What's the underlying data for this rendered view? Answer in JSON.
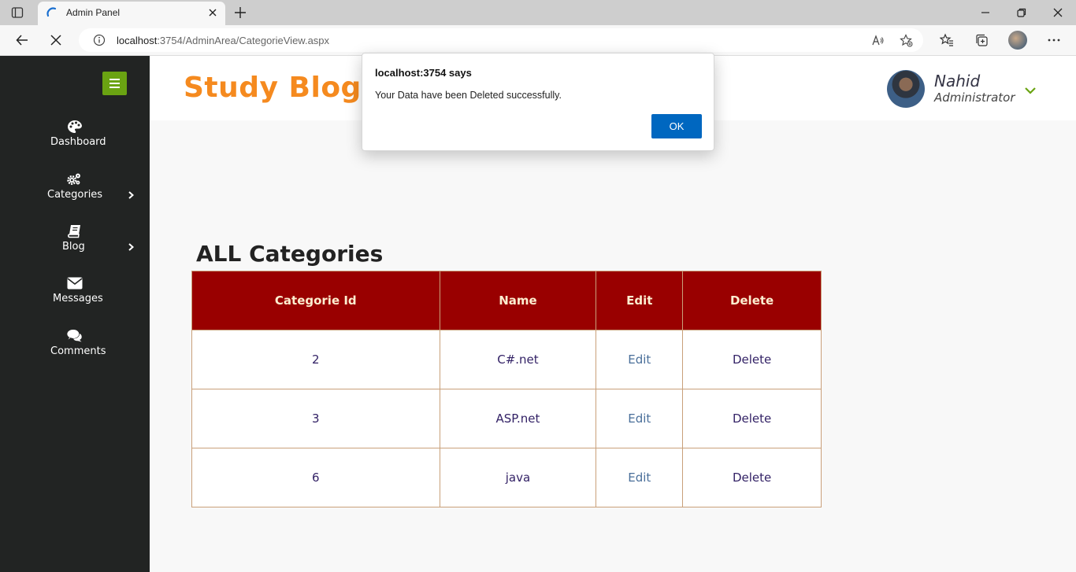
{
  "browser": {
    "tab_title": "Admin Panel",
    "url_host": "localhost",
    "url_rest": ":3754/AdminArea/CategorieView.aspx"
  },
  "sidebar": {
    "items": [
      {
        "label": "Dashboard",
        "icon": "palette-icon"
      },
      {
        "label": "Categories",
        "icon": "gears-icon"
      },
      {
        "label": "Blog",
        "icon": "book-icon"
      },
      {
        "label": "Messages",
        "icon": "envelope-icon"
      },
      {
        "label": "Comments",
        "icon": "comments-icon"
      }
    ]
  },
  "header": {
    "brand": "Study Blog",
    "user_name": "Nahid",
    "user_role": "Administrator"
  },
  "main": {
    "title": "ALL Categories",
    "table": {
      "columns": [
        "Categorie Id",
        "Name",
        "Edit",
        "Delete"
      ],
      "rows": [
        {
          "id": "2",
          "name": "C#.net",
          "edit": "Edit",
          "delete": "Delete"
        },
        {
          "id": "3",
          "name": "ASP.net",
          "edit": "Edit",
          "delete": "Delete"
        },
        {
          "id": "6",
          "name": "java",
          "edit": "Edit",
          "delete": "Delete"
        }
      ]
    }
  },
  "dialog": {
    "title": "localhost:3754 says",
    "message": "Your Data have been Deleted successfully.",
    "ok_label": "OK"
  },
  "colors": {
    "sidebar_bg": "#222423",
    "brand": "#f58a1f",
    "table_header": "#990000",
    "menu_button": "#6aa312",
    "dialog_button": "#0067c0"
  }
}
